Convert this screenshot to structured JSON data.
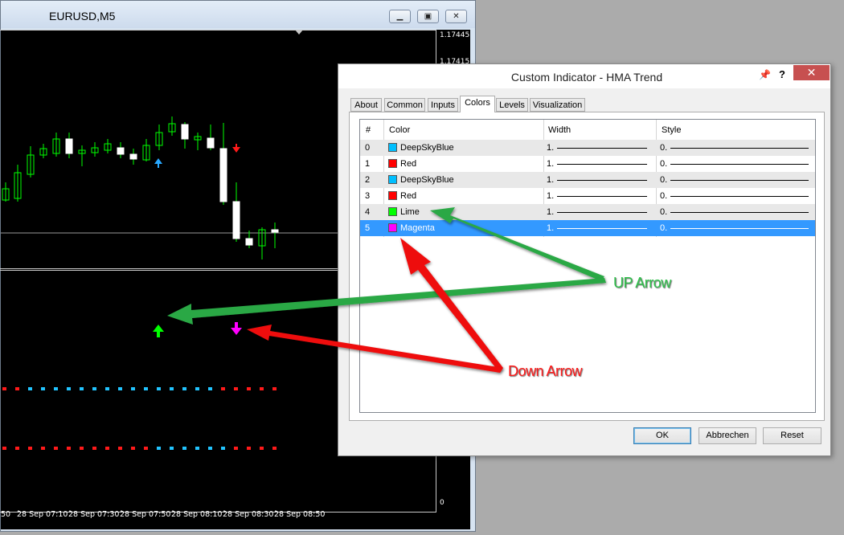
{
  "chart_window": {
    "title": "EURUSD,M5",
    "minimize_icon": "minimize-icon",
    "restore_icon": "restore-icon",
    "close_icon": "close-icon",
    "price_labels": [
      "1.17445",
      "1.17415"
    ],
    "indicator_zero": "0",
    "time_labels": [
      "50",
      "28 Sep 07:10",
      "28 Sep 07:30",
      "28 Sep 07:50",
      "28 Sep 08:10",
      "28 Sep 08:30",
      "28 Sep 08:50"
    ]
  },
  "dialog": {
    "title": "Custom Indicator - HMA Trend",
    "pin_icon": "pin-icon",
    "help_label": "?",
    "tabs": [
      {
        "label": "About"
      },
      {
        "label": "Common"
      },
      {
        "label": "Inputs"
      },
      {
        "label": "Colors",
        "active": true
      },
      {
        "label": "Levels"
      },
      {
        "label": "Visualization"
      }
    ],
    "table": {
      "headers": {
        "num": "#",
        "color": "Color",
        "width": "Width",
        "style": "Style"
      },
      "rows": [
        {
          "num": "0",
          "color": "DeepSkyBlue",
          "hex": "#00bfff",
          "width": "1.",
          "style": "0."
        },
        {
          "num": "1",
          "color": "Red",
          "hex": "#ff0000",
          "width": "1.",
          "style": "0."
        },
        {
          "num": "2",
          "color": "DeepSkyBlue",
          "hex": "#00bfff",
          "width": "1.",
          "style": "0."
        },
        {
          "num": "3",
          "color": "Red",
          "hex": "#ff0000",
          "width": "1.",
          "style": "0."
        },
        {
          "num": "4",
          "color": "Lime",
          "hex": "#00ff00",
          "width": "1.",
          "style": "0."
        },
        {
          "num": "5",
          "color": "Magenta",
          "hex": "#ff00ff",
          "width": "1.",
          "style": "0.",
          "selected": true
        }
      ]
    },
    "buttons": {
      "ok": "OK",
      "cancel": "Abbrechen",
      "reset": "Reset"
    }
  },
  "annotations": {
    "up_arrow": "UP Arrow",
    "down_arrow": "Down Arrow",
    "up_color": "#22a33a",
    "down_color": "#ee1111"
  }
}
